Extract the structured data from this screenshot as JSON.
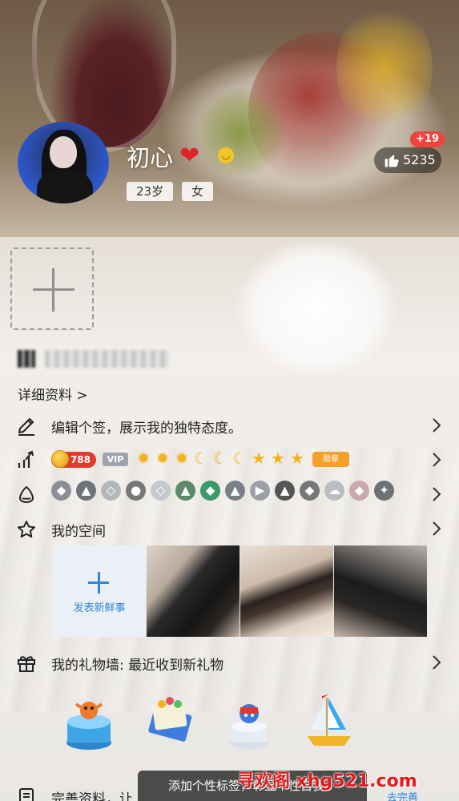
{
  "profile": {
    "nickname": "初心",
    "age": "23岁",
    "gender": "女",
    "like_increment": "+19",
    "like_count": "5235"
  },
  "details": {
    "detail_link": "详细资料 >"
  },
  "rows": {
    "signature": "编辑个签，展示我的独特态度。",
    "my_space": "我的空间",
    "gift_wall": "我的礼物墙: 最近收到新礼物",
    "complete_profile": "完善资料，让"
  },
  "level": {
    "value": "788",
    "vip": "VIP",
    "badge": "勋章",
    "icons": [
      "sun-icon",
      "sun-icon",
      "sun-icon",
      "moon-icon",
      "moon-icon",
      "moon-icon",
      "star-icon",
      "star-icon",
      "star-icon"
    ]
  },
  "space": {
    "add_label": "发表新鲜事"
  },
  "toast": {
    "text": "添加个性标签，彰显个性自我。"
  },
  "watermark": {
    "text": "寻欢阁 xhg521.com"
  },
  "links": {
    "complete_action": "去完善"
  },
  "colors": {
    "accent_blue": "#2f86d6",
    "like_red": "#f0433e",
    "level_red": "#e23a2e"
  }
}
